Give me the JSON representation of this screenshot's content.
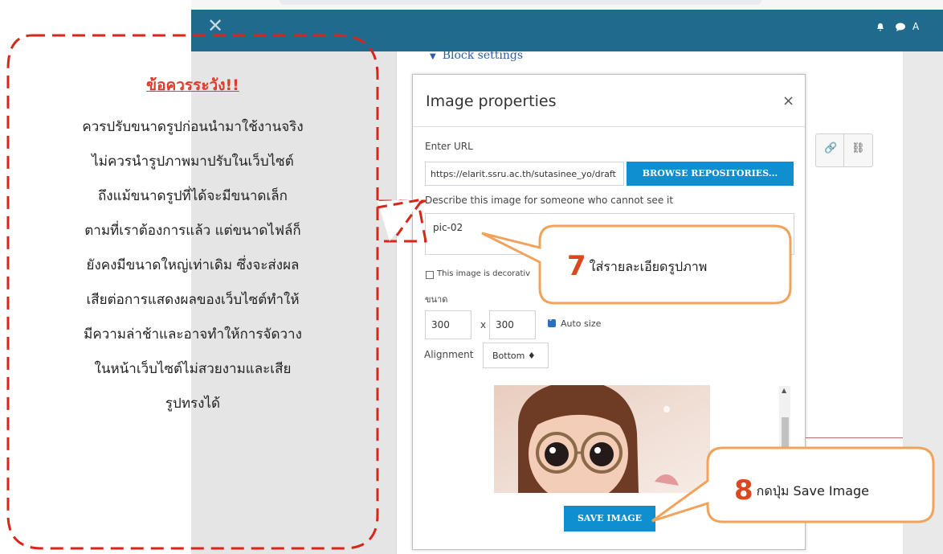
{
  "header": {
    "close_glyph": "✕",
    "user_label": "A"
  },
  "page": {
    "block_settings": "Block settings"
  },
  "modal": {
    "title": "Image properties",
    "close_glyph": "×",
    "enter_url_label": "Enter URL",
    "url_value": "https://elarit.ssru.ac.th/sutasinee_yo/draft",
    "browse_button": "BROWSE REPOSITORIES...",
    "describe_label": "Describe this image for someone who cannot see it",
    "alt_value": "pic-02",
    "decorative_label": "This image is decorativ",
    "size_label": "ขนาด",
    "width_value": "300",
    "size_separator": "x",
    "height_value": "300",
    "auto_size_label": "Auto size",
    "alignment_label": "Alignment",
    "alignment_value": "Bottom ♦",
    "save_button": "SAVE IMAGE"
  },
  "note": {
    "title": "ข้อควรระวัง!!",
    "lines": [
      "ควรปรับขนาดรูปก่อนนำมาใช้งานจริง",
      "ไม่ควรนำรูปภาพมาปรับในเว็บไซต์",
      "ถึงแม้ขนาดรูปที่ได้จะมีขนาดเล็ก",
      "ตามที่เราต้องการแล้ว แต่ขนาดไฟล์ก็",
      "ยังคงมีขนาดใหญ่เท่าเดิม ซึ่งจะส่งผล",
      "เสียต่อการแสดงผลของเว็บไซต์ทำให้",
      "มีความล่าช้าและอาจทำให้การจัดวาง",
      "ในหน้าเว็บไซต์ไม่สวยงามและเสีย",
      "รูปทรงได้"
    ]
  },
  "callouts": {
    "step7_number": "7",
    "step7_text": "ใส่รายละเอียดรูปภาพ",
    "step8_number": "8",
    "step8_text": "กดปุ่ม Save Image"
  },
  "colors": {
    "topbar": "#1f6b8e",
    "primary_button": "#0f8fd0",
    "note_title": "#e03a2a",
    "dash_border": "#d8261b",
    "callout_border": "#f0a35a",
    "step_number": "#d9481e"
  },
  "icons": [
    "close-icon",
    "bell-icon",
    "chat-icon",
    "link-icon",
    "unlink-icon",
    "scroll-up-icon"
  ]
}
